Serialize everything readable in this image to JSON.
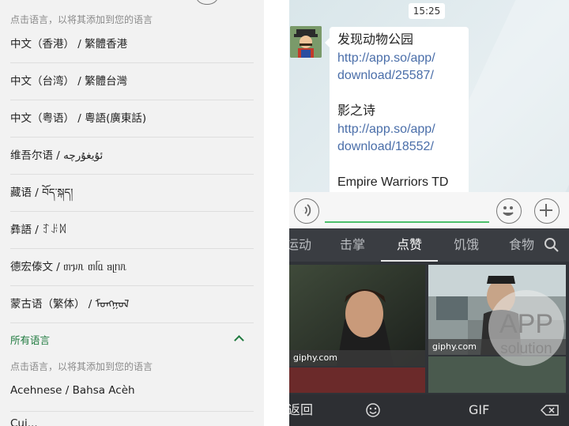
{
  "left_panel": {
    "hint_top": "点击语言，以将其添加到您的语言",
    "languages": [
      "中文（香港） / 繁體香港",
      "中文（台湾） / 繁體台灣",
      "中文（粤语） / 粵語(廣東話)",
      "维吾尔语 / ئۇيغۇرچە",
      "藏语 / བོད་སྐད།",
      "彝語 / ꆈꌠꉙ",
      "德宏傣文 / ᥖᥭᥰ ᥖᥬᥲ ᥑᥨᥒᥰ",
      "蒙古语（繁体） / ᠮᠣᠩᠭᠣᠯ"
    ],
    "section_title": "所有语言",
    "hint_bottom": "点击语言，以将其添加到您的语言",
    "last_language": "Acehnese / Bahsa Acèh",
    "cut_language": "Cuj..."
  },
  "chat": {
    "time": "15:25",
    "message_lines": [
      {
        "text": "发现动物公园",
        "type": "text"
      },
      {
        "text": "http://app.so/app/",
        "type": "link"
      },
      {
        "text": "download/25587/",
        "type": "link"
      },
      {
        "text": "",
        "type": "gap"
      },
      {
        "text": "影之诗",
        "type": "text"
      },
      {
        "text": "http://app.so/app/",
        "type": "link"
      },
      {
        "text": "download/18552/",
        "type": "link"
      },
      {
        "text": "",
        "type": "gap"
      },
      {
        "text": "Empire Warriors TD",
        "type": "text"
      }
    ]
  },
  "keyboard": {
    "tabs": [
      "运动",
      "击掌",
      "点赞",
      "饥饿",
      "食物"
    ],
    "active_tab": "点赞",
    "gifs": [
      {
        "caption": "giphy.com"
      },
      {
        "caption": "giphy.com"
      }
    ],
    "back_label": "返回",
    "gif_label": "GIF"
  },
  "watermark": {
    "line1": "APP",
    "line2": "solution"
  },
  "colors": {
    "accent_green": "#1f7a3f",
    "link_blue": "#4a6ea9",
    "input_green": "#4cbf6b",
    "keyboard_bg": "#303338"
  }
}
